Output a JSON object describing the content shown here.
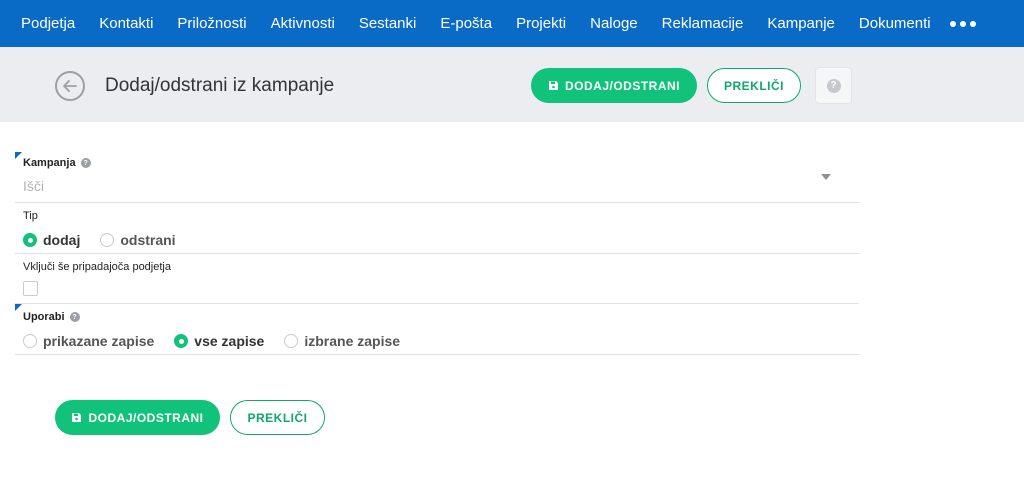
{
  "nav": {
    "items": [
      "Podjetja",
      "Kontakti",
      "Priložnosti",
      "Aktivnosti",
      "Sestanki",
      "E-pošta",
      "Projekti",
      "Naloge",
      "Reklamacije",
      "Kampanje",
      "Dokumenti"
    ],
    "more_icon": "more-dots-icon"
  },
  "header": {
    "title": "Dodaj/odstrani iz kampanje",
    "save_label": "DODAJ/ODSTRANI",
    "cancel_label": "PREKLIČI",
    "help_label": "?"
  },
  "form": {
    "campaign": {
      "label": "Kampanja",
      "placeholder": "Išči"
    },
    "type": {
      "label": "Tip",
      "options": [
        "dodaj",
        "odstrani"
      ],
      "selected": "dodaj"
    },
    "include": {
      "label": "Vključi še pripadajoča podjetja",
      "checked": false
    },
    "use": {
      "label": "Uporabi",
      "options": [
        "prikazane zapise",
        "vse zapise",
        "izbrane zapise"
      ],
      "selected": "vse zapise"
    }
  },
  "footer": {
    "save_label": "DODAJ/ODSTRANI",
    "cancel_label": "PREKLIČI"
  },
  "colors": {
    "nav_bg": "#0a6bc6",
    "accent": "#10c27a",
    "header_bg": "#ebedf0"
  }
}
